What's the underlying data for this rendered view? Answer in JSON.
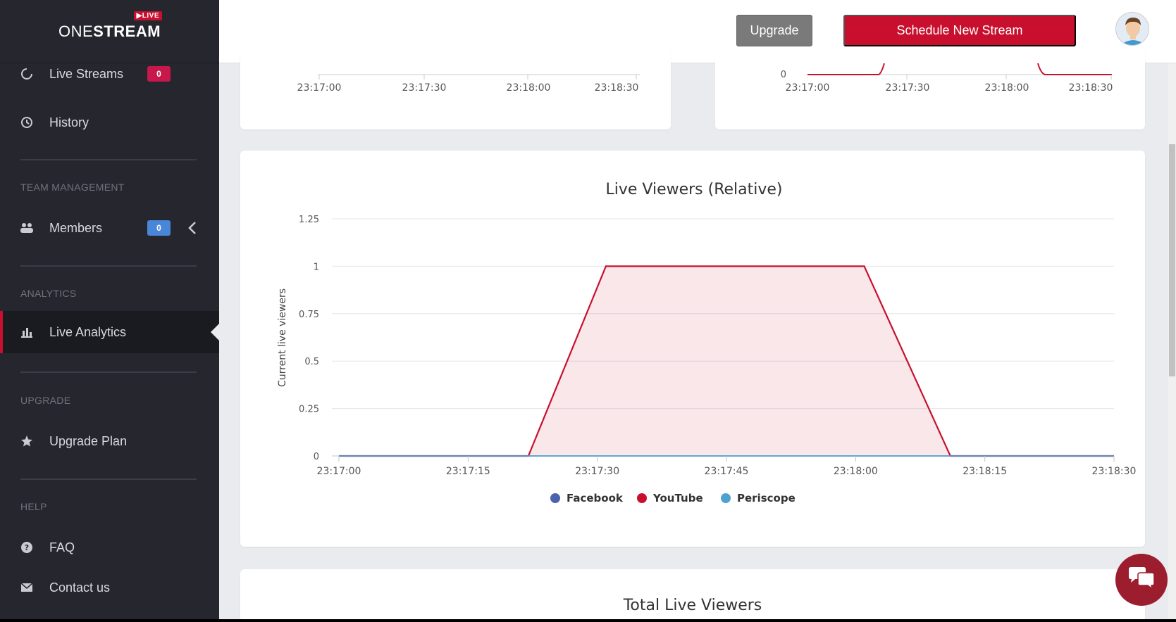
{
  "brand": {
    "name_light": "ONE",
    "name_bold": "STREAM",
    "live_tag": "LIVE"
  },
  "sidebar": {
    "items": [
      {
        "label": "Live Streams",
        "badge": "0",
        "icon": "refresh-icon"
      },
      {
        "label": "History",
        "icon": "clock-icon"
      },
      {
        "label": "Members",
        "badge": "0",
        "icon": "users-icon"
      },
      {
        "label": "Live Analytics",
        "icon": "bar-chart-icon"
      },
      {
        "label": "Upgrade Plan",
        "icon": "star-icon"
      },
      {
        "label": "FAQ",
        "icon": "question-icon"
      },
      {
        "label": "Contact us",
        "icon": "envelope-icon"
      }
    ],
    "sections": {
      "team": "TEAM MANAGEMENT",
      "analytics": "ANALYTICS",
      "upgrade": "UPGRADE",
      "help": "HELP"
    }
  },
  "header": {
    "upgrade_label": "Upgrade",
    "schedule_label": "Schedule New Stream"
  },
  "top_charts": {
    "left_ticks": [
      "23:17:00",
      "23:17:30",
      "23:18:00",
      "23:18:30"
    ],
    "right_ticks": [
      "23:17:00",
      "23:17:30",
      "23:18:00",
      "23:18:30"
    ],
    "right_y_zero": "0"
  },
  "colors": {
    "accent": "#c8102e",
    "facebook": "#4a62b0",
    "youtube": "#c8102e",
    "periscope": "#4da3cf"
  },
  "chart_data": {
    "type": "area",
    "title": "Live Viewers (Relative)",
    "ylabel": "Current live viewers",
    "xlabel": "",
    "ylim": [
      0,
      1.25
    ],
    "y_ticks": [
      "0",
      "0.25",
      "0.5",
      "0.75",
      "1",
      "1.25"
    ],
    "x_ticks": [
      "23:17:00",
      "23:17:15",
      "23:17:30",
      "23:17:45",
      "23:18:00",
      "23:18:15",
      "23:18:30"
    ],
    "legend_position": "bottom",
    "series": [
      {
        "name": "Facebook",
        "color": "#4a62b0",
        "x": [
          "23:17:00",
          "23:18:30"
        ],
        "values": [
          0,
          0
        ]
      },
      {
        "name": "YouTube",
        "color": "#c8102e",
        "x": [
          "23:17:00",
          "23:17:22",
          "23:17:31",
          "23:18:01",
          "23:18:11",
          "23:18:30"
        ],
        "values": [
          0,
          0,
          1,
          1,
          0,
          0
        ]
      },
      {
        "name": "Periscope",
        "color": "#4da3cf",
        "x": [
          "23:17:00",
          "23:18:30"
        ],
        "values": [
          0,
          0
        ]
      }
    ]
  },
  "next_card": {
    "title": "Total Live Viewers"
  }
}
